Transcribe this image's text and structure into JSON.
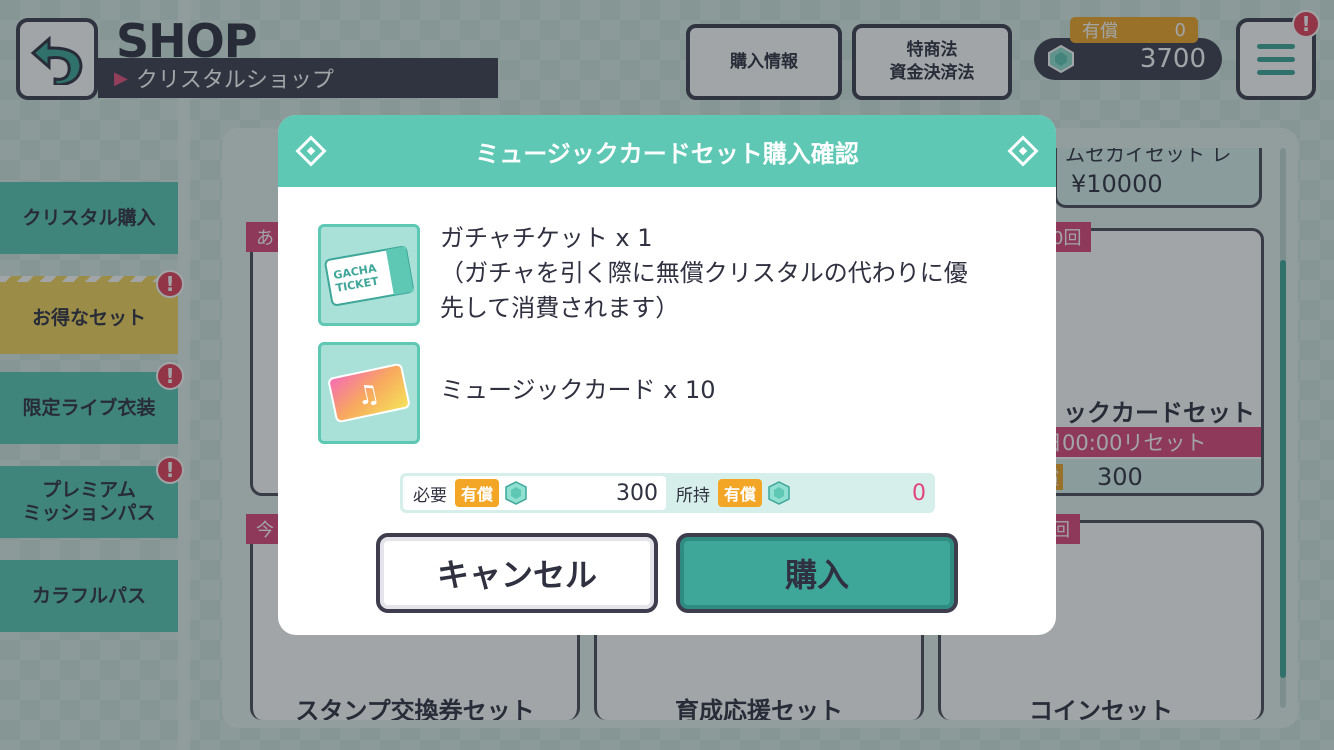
{
  "header": {
    "title": "SHOP",
    "subtitle": "クリスタルショップ",
    "purchase_info": "購入情報",
    "legal_line1": "特商法",
    "legal_line2": "資金決済法",
    "paid_label": "有償",
    "paid_value": "0",
    "crystal_count": "3700",
    "alert": "!"
  },
  "sidebar": {
    "items": [
      {
        "label": "クリスタル購入"
      },
      {
        "label": "お得なセット"
      },
      {
        "label": "限定ライブ衣装"
      },
      {
        "label": "プレミアム\nミッションパス"
      },
      {
        "label": "カラフルパス"
      }
    ]
  },
  "background": {
    "price_top": "¥10000",
    "card_right_label": "ックカードセット",
    "card_right_reset": "日00:00リセット",
    "card_right_price": "300",
    "card_right_paid_fragment": "償",
    "card_right_top_fragment": "ムセカイセット レ",
    "ribbon_a": "あ",
    "ribbon_b": "0回",
    "ribbon_c": "今",
    "ribbon_d": "回",
    "bottom_left": "スタンプ交換券セット",
    "bottom_mid": "育成応援セット",
    "bottom_right": "コインセット"
  },
  "dialog": {
    "title": "ミュージックカードセット購入確認",
    "item1_line1": "ガチャチケット x 1",
    "item1_line2": "（ガチャを引く際に無償クリスタルの代わりに優",
    "item1_line3": "先して消費されます）",
    "item2": "ミュージックカード x 10",
    "required_label": "必要",
    "paid_tag": "有償",
    "required_value": "300",
    "owned_label": "所持",
    "owned_tag": "有償",
    "owned_value": "0",
    "cancel": "キャンセル",
    "buy": "購入",
    "ticket_text1": "GACHA",
    "ticket_text2": "TICKET"
  },
  "colors": {
    "accent": "#5ec8b5",
    "dark": "#3d3d4e",
    "paid": "#f3a626",
    "alert": "#e33f5a"
  }
}
